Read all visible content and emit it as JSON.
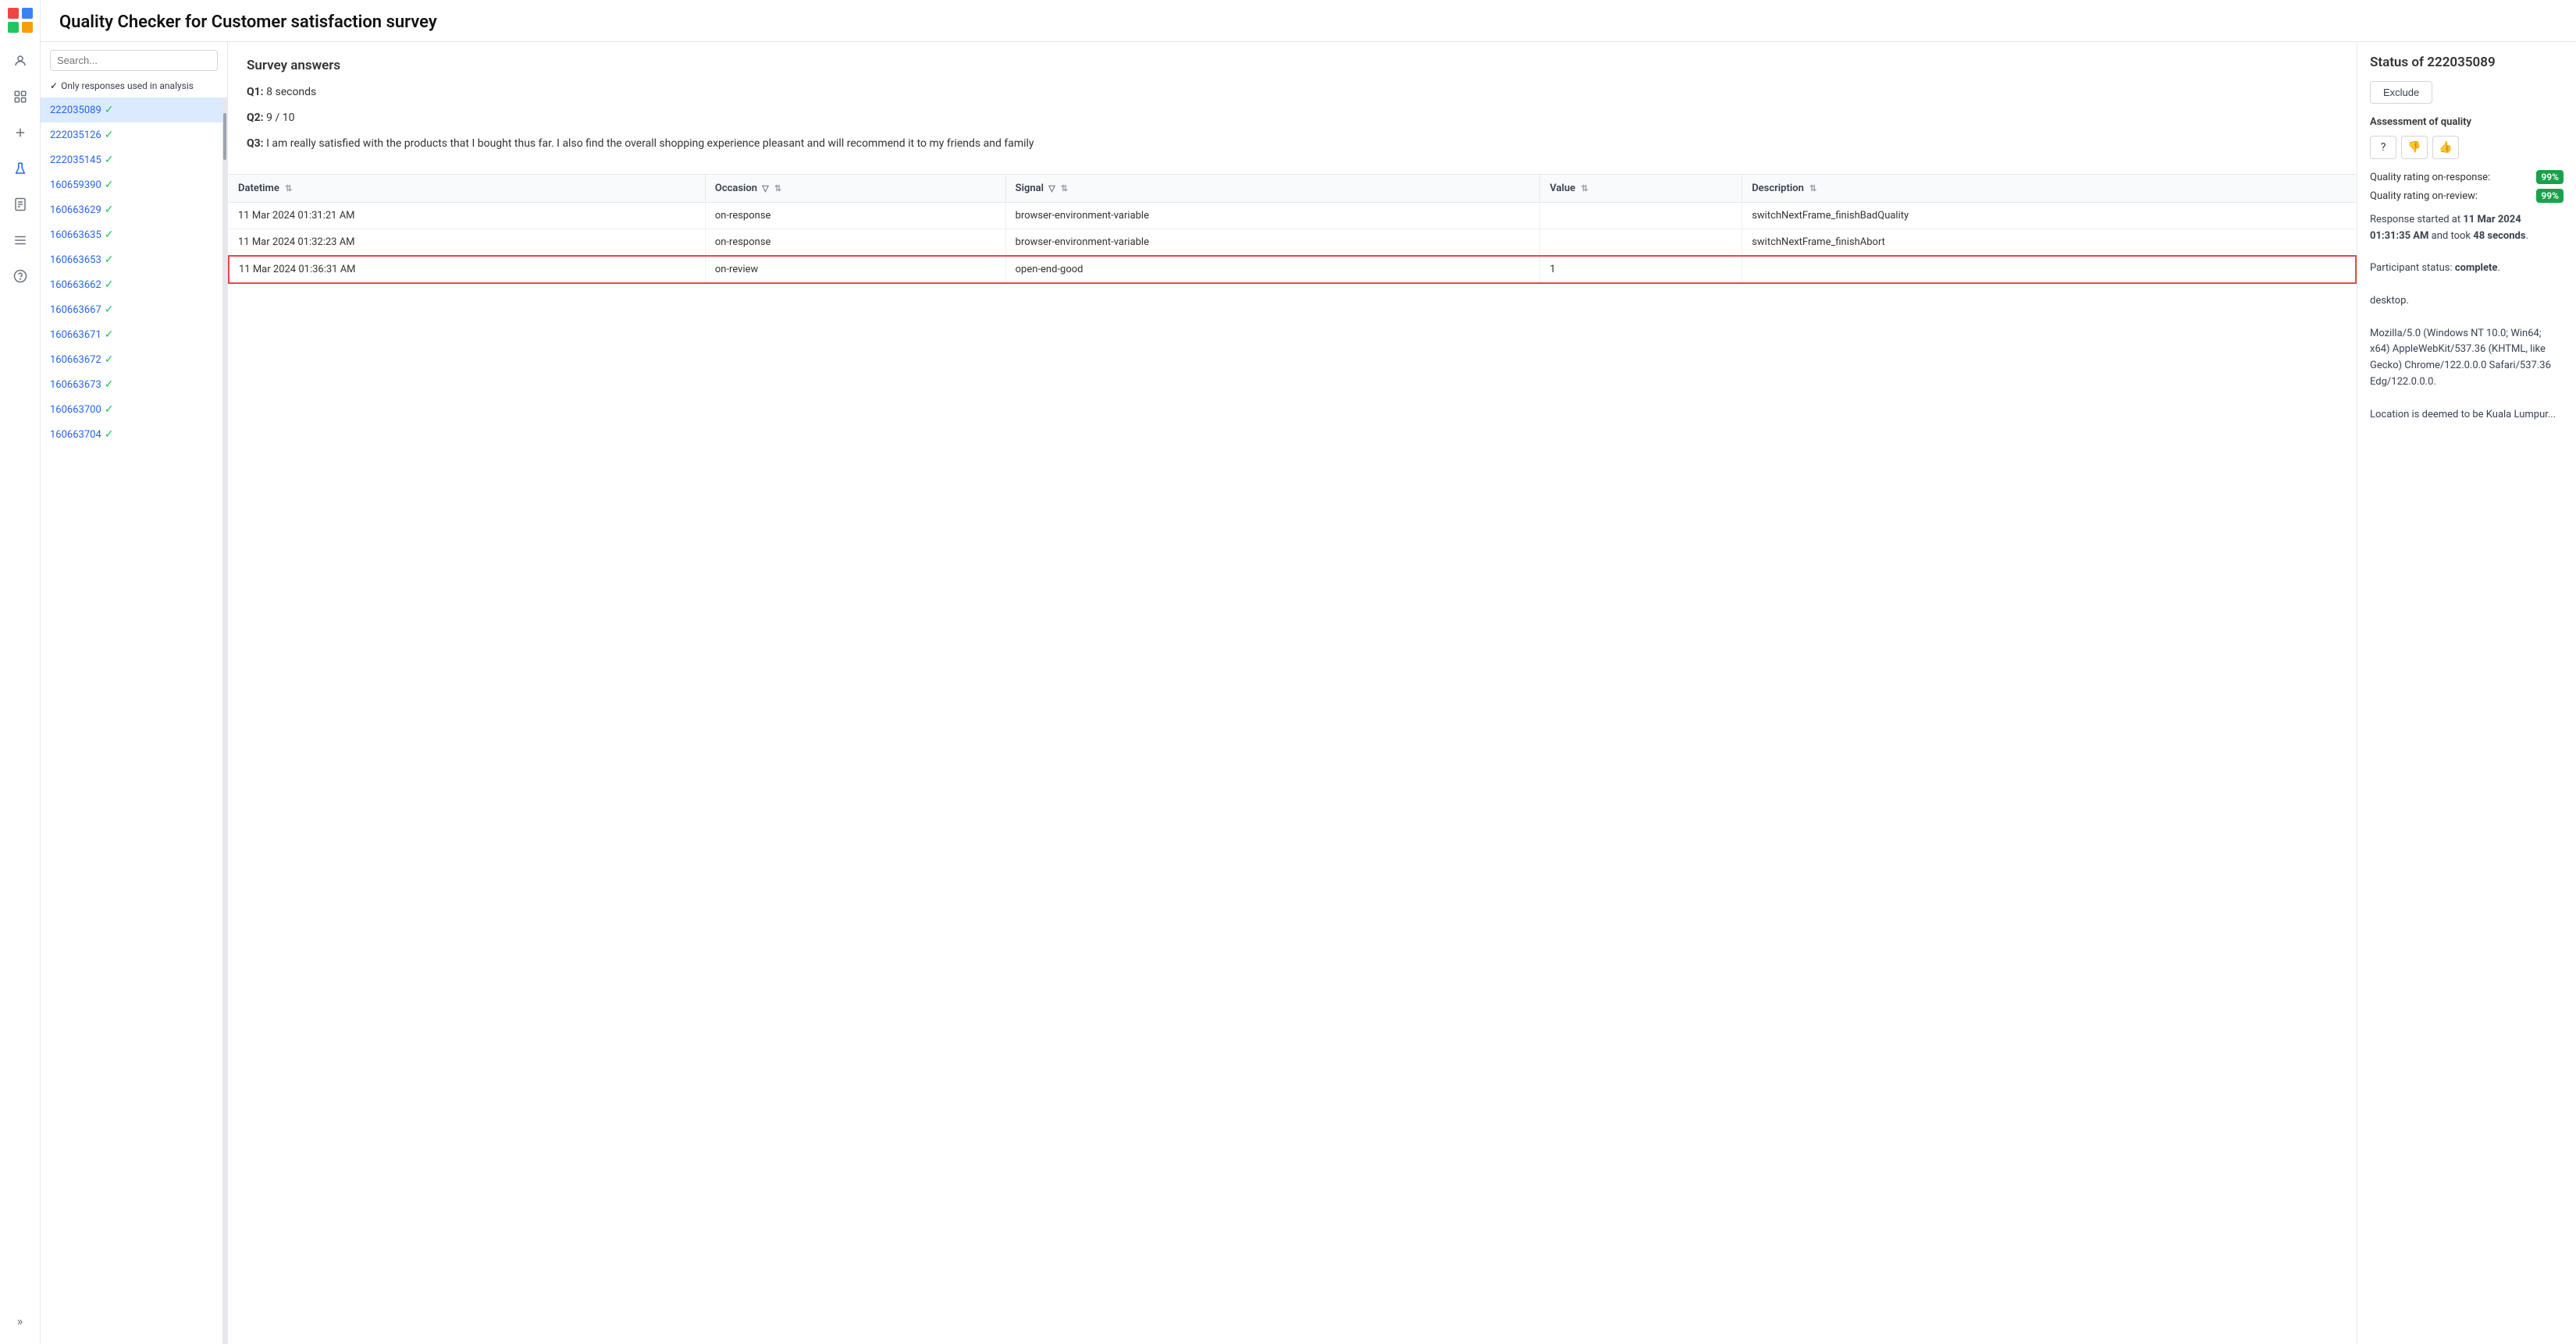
{
  "app": {
    "title": "Quality Checker for Customer satisfaction survey"
  },
  "nav": {
    "icons": [
      {
        "name": "person-icon",
        "glyph": "👤",
        "active": false
      },
      {
        "name": "chart-icon",
        "glyph": "📊",
        "active": false
      },
      {
        "name": "plus-icon",
        "glyph": "＋",
        "active": false
      },
      {
        "name": "flask-icon",
        "glyph": "🧪",
        "active": true
      },
      {
        "name": "doc-icon",
        "glyph": "📄",
        "active": false
      },
      {
        "name": "list-icon",
        "glyph": "☰",
        "active": false
      },
      {
        "name": "help-icon",
        "glyph": "？",
        "active": false
      }
    ],
    "expand_label": "»"
  },
  "sidebar": {
    "search_placeholder": "Search...",
    "filter_label": "Only responses used in analysis",
    "filter_checked": true,
    "items": [
      {
        "id": "222035089",
        "active": true,
        "checkmark": true
      },
      {
        "id": "222035126",
        "active": false,
        "checkmark": true
      },
      {
        "id": "222035145",
        "active": false,
        "checkmark": true
      },
      {
        "id": "160659390",
        "active": false,
        "checkmark": true
      },
      {
        "id": "160663629",
        "active": false,
        "checkmark": true
      },
      {
        "id": "160663635",
        "active": false,
        "checkmark": true
      },
      {
        "id": "160663653",
        "active": false,
        "checkmark": true
      },
      {
        "id": "160663662",
        "active": false,
        "checkmark": true
      },
      {
        "id": "160663667",
        "active": false,
        "checkmark": true
      },
      {
        "id": "160663671",
        "active": false,
        "checkmark": true
      },
      {
        "id": "160663672",
        "active": false,
        "checkmark": true
      },
      {
        "id": "160663673",
        "active": false,
        "checkmark": true
      },
      {
        "id": "160663700",
        "active": false,
        "checkmark": true
      },
      {
        "id": "160663704",
        "active": false,
        "checkmark": true
      }
    ]
  },
  "survey": {
    "title": "Survey answers",
    "q1_label": "Q1:",
    "q1_value": "8 seconds",
    "q2_label": "Q2:",
    "q2_value": "9 / 10",
    "q3_label": "Q3:",
    "q3_value": "I am really satisfied with the products that I bought thus far. I also find the overall shopping experience pleasant and will recommend it to my friends and family"
  },
  "table": {
    "columns": [
      {
        "key": "datetime",
        "label": "Datetime",
        "sortable": true,
        "filterable": false
      },
      {
        "key": "occasion",
        "label": "Occasion",
        "sortable": true,
        "filterable": true
      },
      {
        "key": "signal",
        "label": "Signal",
        "sortable": true,
        "filterable": true
      },
      {
        "key": "value",
        "label": "Value",
        "sortable": true,
        "filterable": false
      },
      {
        "key": "description",
        "label": "Description",
        "sortable": true,
        "filterable": false
      }
    ],
    "rows": [
      {
        "datetime": "11 Mar 2024 01:31:21 AM",
        "occasion": "on-response",
        "signal": "browser-environment-variable",
        "value": "",
        "description": "switchNextFrame_finishBadQuality",
        "highlighted": false
      },
      {
        "datetime": "11 Mar 2024 01:32:23 AM",
        "occasion": "on-response",
        "signal": "browser-environment-variable",
        "value": "",
        "description": "switchNextFrame_finishAbort",
        "highlighted": false
      },
      {
        "datetime": "11 Mar 2024 01:36:31 AM",
        "occasion": "on-review",
        "signal": "open-end-good",
        "value": "1",
        "description": "",
        "highlighted": true
      }
    ]
  },
  "status_panel": {
    "title": "Status of 222035089",
    "exclude_label": "Exclude",
    "assessment_title": "Assessment of quality",
    "quality_buttons": [
      {
        "name": "unknown-btn",
        "glyph": "?",
        "type": "neutral"
      },
      {
        "name": "thumbs-down-btn",
        "glyph": "👎",
        "type": "negative"
      },
      {
        "name": "thumbs-up-btn",
        "glyph": "👍",
        "type": "positive"
      }
    ],
    "quality_rating_response_label": "Quality rating on-response:",
    "quality_rating_response_value": "99%",
    "quality_rating_review_label": "Quality rating on-review:",
    "quality_rating_review_value": "99%",
    "meta_line1": "Response started at ",
    "meta_date": "11 Mar 2024",
    "meta_time": "01:31:35 AM",
    "meta_took": " and took ",
    "meta_seconds": "48 seconds",
    "meta_line2": "Participant status: ",
    "meta_status": "complete",
    "meta_device": "desktop.",
    "meta_ua": "Mozilla/5.0 (Windows NT 10.0; Win64; x64) AppleWebKit/537.36 (KHTML, like Gecko) Chrome/122.0.0.0 Safari/537.36 Edg/122.0.0.0.",
    "meta_location": "Location is deemed to be Kuala Lumpur..."
  }
}
